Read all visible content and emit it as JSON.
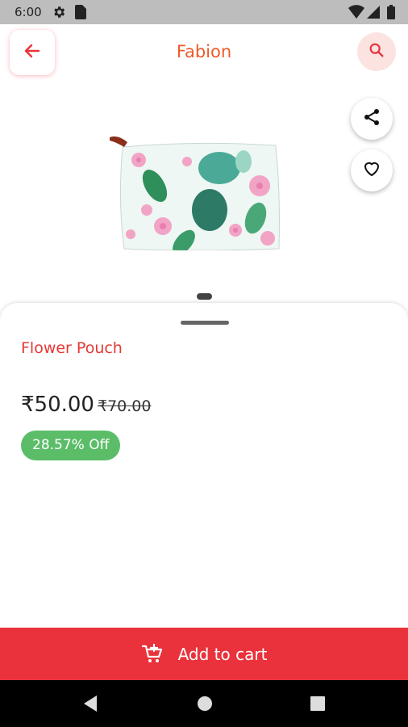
{
  "status_bar": {
    "time": "6:00",
    "icons": [
      "settings-icon",
      "sim-card-icon",
      "wifi-icon",
      "signal-icon",
      "battery-icon"
    ]
  },
  "header": {
    "title": "Fabion",
    "back_icon": "arrow-left-icon",
    "search_icon": "search-icon"
  },
  "product": {
    "image": "flower-pouch-image",
    "share_icon": "share-icon",
    "favorite_icon": "heart-icon",
    "carousel_index": 1,
    "name": "Flower Pouch",
    "price": "₹50.00",
    "original_price": "₹70.00",
    "discount": "28.57% Off"
  },
  "actions": {
    "add_to_cart": "Add to cart",
    "cart_icon": "add-to-cart-icon"
  },
  "nav_bar": {
    "icons": [
      "back-triangle-icon",
      "home-circle-icon",
      "recents-square-icon"
    ]
  },
  "colors": {
    "accent": "#e9323b",
    "title": "#ee5a2a",
    "discount_badge": "#5cbd69",
    "search_bg": "#fbe3e1"
  }
}
